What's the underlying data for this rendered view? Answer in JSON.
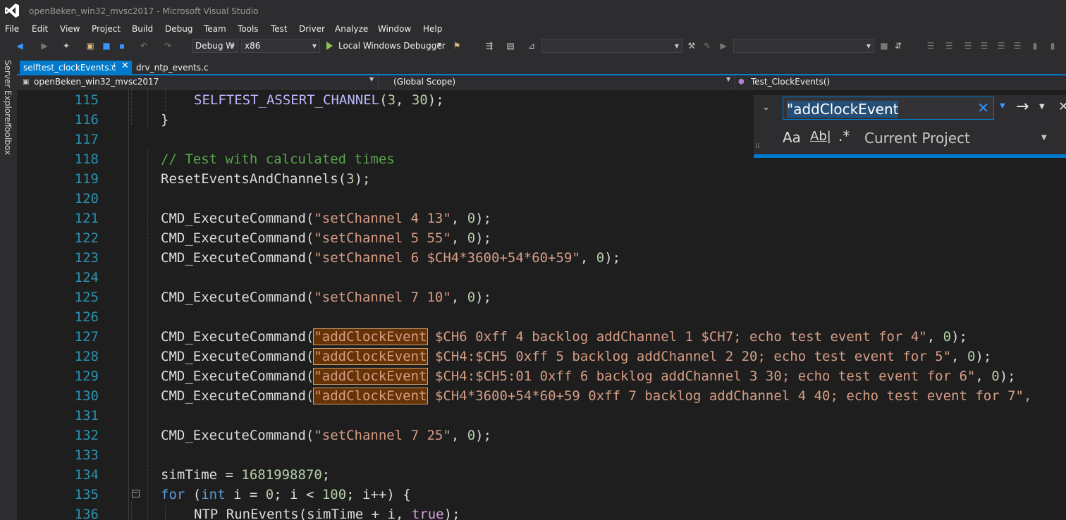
{
  "window": {
    "title": "openBeken_win32_mvsc2017 - Microsoft Visual Studio"
  },
  "menu": [
    "File",
    "Edit",
    "View",
    "Project",
    "Build",
    "Debug",
    "Team",
    "Tools",
    "Test",
    "Driver",
    "Analyze",
    "Window",
    "Help"
  ],
  "toolbar": {
    "config": "Debug W",
    "platform": "x86",
    "run_label": "Local Windows Debugger",
    "combo_empty_1": "",
    "combo_empty_2": ""
  },
  "side_tabs": [
    "Server Explorer",
    "Toolbox"
  ],
  "tabs": [
    {
      "label": "selftest_clockEvents.c",
      "active": true
    },
    {
      "label": "drv_ntp_events.c",
      "active": false
    }
  ],
  "navbar": {
    "project": "openBeken_win32_mvsc2017",
    "scope": "(Global Scope)",
    "function": "Test_ClockEvents()"
  },
  "find": {
    "query": "\"addClockEvent",
    "scope": "Current Project",
    "match_case_glyph": "Aa",
    "whole_word_glyph": "Ab|",
    "regex_glyph": ".*"
  },
  "code": {
    "line_numbers": [
      "115",
      "116",
      "117",
      "118",
      "119",
      "120",
      "121",
      "122",
      "123",
      "124",
      "125",
      "126",
      "127",
      "128",
      "129",
      "130",
      "131",
      "132",
      "133",
      "134",
      "135",
      "136"
    ],
    "l115": {
      "fn": "SELFTEST_ASSERT_CHANNEL",
      "open": "(",
      "a": "3",
      "comma": ", ",
      "b": "30",
      "close": ");"
    },
    "l116": "}",
    "l118": "// Test with calculated times",
    "l119": {
      "fn": "ResetEventsAndChannels(",
      "a": "3",
      "close": ");"
    },
    "cmd_fn": "CMD_ExecuteCommand(",
    "zero": "0",
    "tail": ", ",
    "end": ");",
    "l121": "\"setChannel 4 13\"",
    "l122": "\"setChannel 5 55\"",
    "l123": "\"setChannel 6 $CH4*3600+54*60+59\"",
    "l125": "\"setChannel 7 10\"",
    "hl": "\"addClockEvent",
    "l127": " $CH6 0xff 4 backlog addChannel 1 $CH7; echo test event for 4\"",
    "l128": " $CH4:$CH5 0xff 5 backlog addChannel 2 20; echo test event for 5\"",
    "l129": " $CH4:$CH5:01 0xff 6 backlog addChannel 3 30; echo test event for 6\"",
    "l130": " $CH4*3600+54*60+59 0xff 7 backlog addChannel 4 40; echo test event for 7\",",
    "l132": "\"setChannel 7 25\"",
    "l134": {
      "a": "simTime = ",
      "num": "1681998870",
      "end": ";"
    },
    "l135": {
      "kw": "for",
      "p1": " (",
      "kw2": "int",
      "p2": " i = ",
      "n0": "0",
      "p3": "; i < ",
      "n100": "100",
      "p4": "; i++) {"
    },
    "l136": {
      "a": "NTP_RunEvents(simTime + i, ",
      "kw": "true",
      "end": ");"
    }
  }
}
